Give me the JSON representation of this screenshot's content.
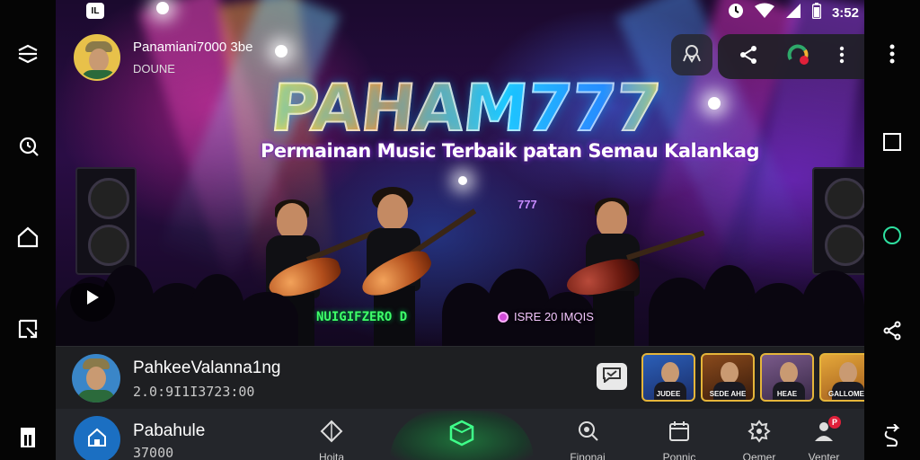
{
  "status_bar": {
    "left_icon_label": "IL",
    "time": "3:52",
    "icons": [
      "alarm-icon",
      "wifi-icon",
      "signal-icon",
      "battery-icon"
    ]
  },
  "system_left": [
    "back-swipe-icon",
    "rotate-icon",
    "home-outline-icon",
    "screenshot-icon"
  ],
  "system_right": [
    "more-vert-icon",
    "square-icon",
    "circle-icon",
    "share-icon",
    "swap-icon"
  ],
  "channel": {
    "name": "Panamiani7000 3be",
    "sub": "DOUNE"
  },
  "overlay_actions": {
    "cast_icon": "cast-icon",
    "share_icon": "share-icon",
    "avatar_icon": "profile-icon",
    "more_icon": "more-vert-icon"
  },
  "hero": {
    "logo": "PAHAM777",
    "tagline": "Permainan Music Terbaik patan Semau Kalankag",
    "mini_label": "777",
    "badge_green": "NUIGIFZERO D",
    "badge_pink": "ISRE 20 IMQIS"
  },
  "info_row": {
    "title": "PahkeeValanna1ng",
    "sub": "2.0:9I1I3723:00",
    "thumbnails": [
      {
        "label": "JUDEE",
        "colors": [
          "#2b5fb8",
          "#1b2e6a"
        ]
      },
      {
        "label": "SEDE AHE",
        "colors": [
          "#8a4a1c",
          "#3a1c0c"
        ]
      },
      {
        "label": "HEAE",
        "colors": [
          "#7a5a8a",
          "#3a2a48"
        ]
      },
      {
        "label": "GALLOME",
        "colors": [
          "#e5a83a",
          "#a05a1c"
        ]
      }
    ]
  },
  "bottom_nav": {
    "home_label": "Pabahule",
    "home_sub": "37000",
    "items": [
      {
        "label": "Hoita",
        "icon": "diamond-icon"
      },
      {
        "label": "",
        "icon": "cube-icon"
      },
      {
        "label": "Finonai",
        "icon": "search-icon"
      },
      {
        "label": "Ponnic",
        "icon": "calendar-icon"
      },
      {
        "label": "Oemer",
        "icon": "settings-icon"
      },
      {
        "label": "Venter",
        "icon": "profile-icon"
      }
    ],
    "notification_count": "P"
  },
  "colors": {
    "accent_blue": "#1b6fc2",
    "accent_green": "#3fff6a",
    "bar_bg": "#24262b",
    "row_bg": "#1e1f22"
  }
}
